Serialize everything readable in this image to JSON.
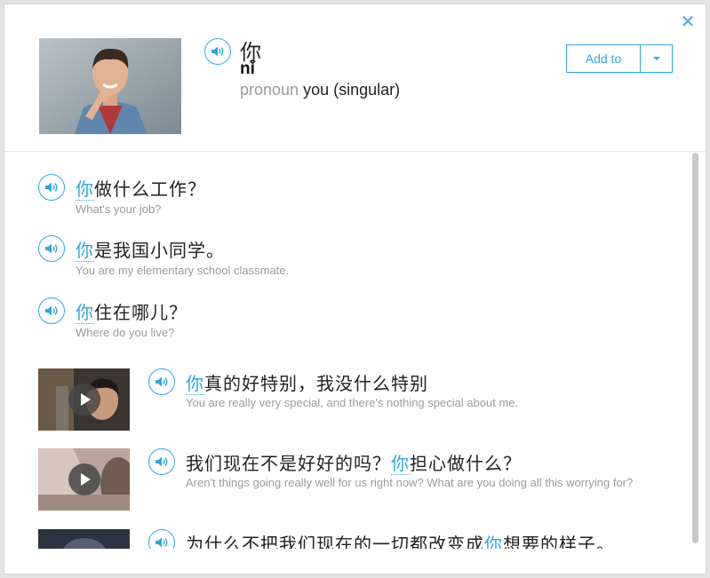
{
  "word": {
    "hanzi": "你",
    "pinyin": "nǐ",
    "part_of_speech": "pronoun",
    "gloss": "you (singular)",
    "add_to_label": "Add to"
  },
  "examples": [
    {
      "highlight": "你",
      "rest": "做什么工作？",
      "english": "What's your job?"
    },
    {
      "highlight": "你",
      "rest": "是我国小同学。",
      "english": "You are my elementary school classmate."
    },
    {
      "highlight": "你",
      "rest": "住在哪儿？",
      "english": "Where do you live?"
    }
  ],
  "video_examples": [
    {
      "before": "",
      "highlight": "你",
      "after": "真的好特别，我没什么特别",
      "english": "You are really very special, and there's nothing special about me."
    },
    {
      "before": "我们现在不是好好的吗？",
      "highlight": "你",
      "after": "担心做什么？",
      "english": "Aren't things going really well for us right now? What are you doing all this worrying for?"
    },
    {
      "before": "为什么不把我们现在的一切都改变成",
      "highlight": "你",
      "after": "想要的样子。",
      "english": ""
    }
  ],
  "icons": {
    "close": "close-icon",
    "audio": "speaker-icon",
    "caret": "caret-down-icon",
    "play": "play-icon"
  },
  "colors": {
    "accent": "#2fa8dd",
    "muted_text": "#9b9b9b",
    "body_text": "#222222"
  }
}
